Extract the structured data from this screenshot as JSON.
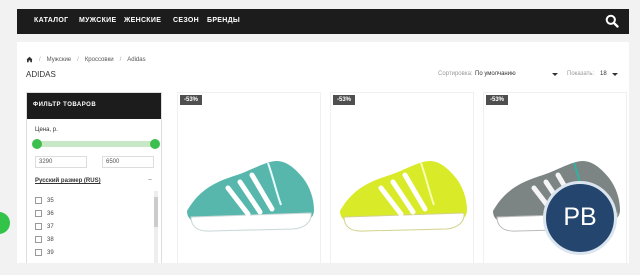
{
  "nav": {
    "items": [
      "КАТАЛОГ",
      "МУЖСКИЕ",
      "ЖЕНСКИЕ",
      "СЕЗОН",
      "БРЕНДЫ"
    ],
    "search_icon": "search-icon"
  },
  "breadcrumb": {
    "items": [
      "Мужские",
      "Кроссовки",
      "Adidas"
    ]
  },
  "page": {
    "title": "ADIDAS"
  },
  "controls": {
    "sort_label": "Сортировка:",
    "sort_value": "По умолчанию",
    "show_label": "Показать:",
    "show_value": "18"
  },
  "filter": {
    "title": "ФИЛЬТР ТОВАРОВ",
    "price_label": "Цена, р.",
    "price_min": "3290",
    "price_max": "6500",
    "size_title": "Русский размер (RUS)",
    "size_toggle": "−",
    "sizes": [
      "35",
      "36",
      "37",
      "38",
      "39"
    ]
  },
  "products": [
    {
      "discount": "-53%",
      "color": "#58b7ad"
    },
    {
      "discount": "-53%",
      "color": "#d9ea28"
    },
    {
      "discount": "-53%",
      "color": "#7d8584"
    }
  ],
  "watermark": {
    "text": "PB"
  }
}
